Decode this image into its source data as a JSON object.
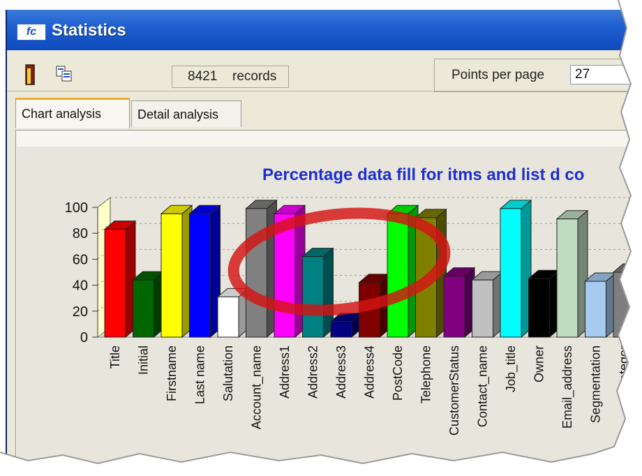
{
  "window": {
    "title": "Statistics",
    "app_icon": "fc"
  },
  "toolbar": {
    "exit_icon": "exit-door-icon",
    "copy_icon": "copy-icon",
    "records_count": "8421",
    "records_label": "records",
    "points_label": "Points per page",
    "points_value": "27"
  },
  "tabs": [
    {
      "label": "Chart analysis",
      "active": true
    },
    {
      "label": "Detail analysis",
      "active": false
    }
  ],
  "colors": {
    "title_text": "#1c2fd0",
    "callout": "#d41414",
    "titlebar": "#1f5fd1"
  },
  "chart_data": {
    "type": "bar",
    "title": "Percentage data fill for itms and list d co",
    "ylim": [
      0,
      100
    ],
    "yticks": [
      "100",
      "80",
      "60",
      "40",
      "20",
      "0"
    ],
    "grid": true,
    "categories": [
      "Title",
      "Initial",
      "Firstname",
      "Last name",
      "Salutation",
      "Account_name",
      "Address1",
      "Address2",
      "Address3",
      "Address4",
      "PostCode",
      "Telephone",
      "CustomerStatus",
      "Contact_name",
      "Job_title",
      "Owner",
      "Email_address",
      "Segmentation",
      "Categor"
    ],
    "values": [
      83,
      44,
      95,
      95,
      31,
      99,
      95,
      62,
      12,
      42,
      95,
      92,
      47,
      44,
      99,
      45,
      91,
      43,
      50
    ],
    "colors": [
      "#ff0000",
      "#006600",
      "#ffff00",
      "#0000ff",
      "#ffffff",
      "#808080",
      "#ff00ff",
      "#008080",
      "#000080",
      "#800000",
      "#00ff00",
      "#808000",
      "#800080",
      "#c0c0c0",
      "#00ffff",
      "#000000",
      "#c0dcc0",
      "#a6caf0",
      "#7f7f7f"
    ]
  }
}
